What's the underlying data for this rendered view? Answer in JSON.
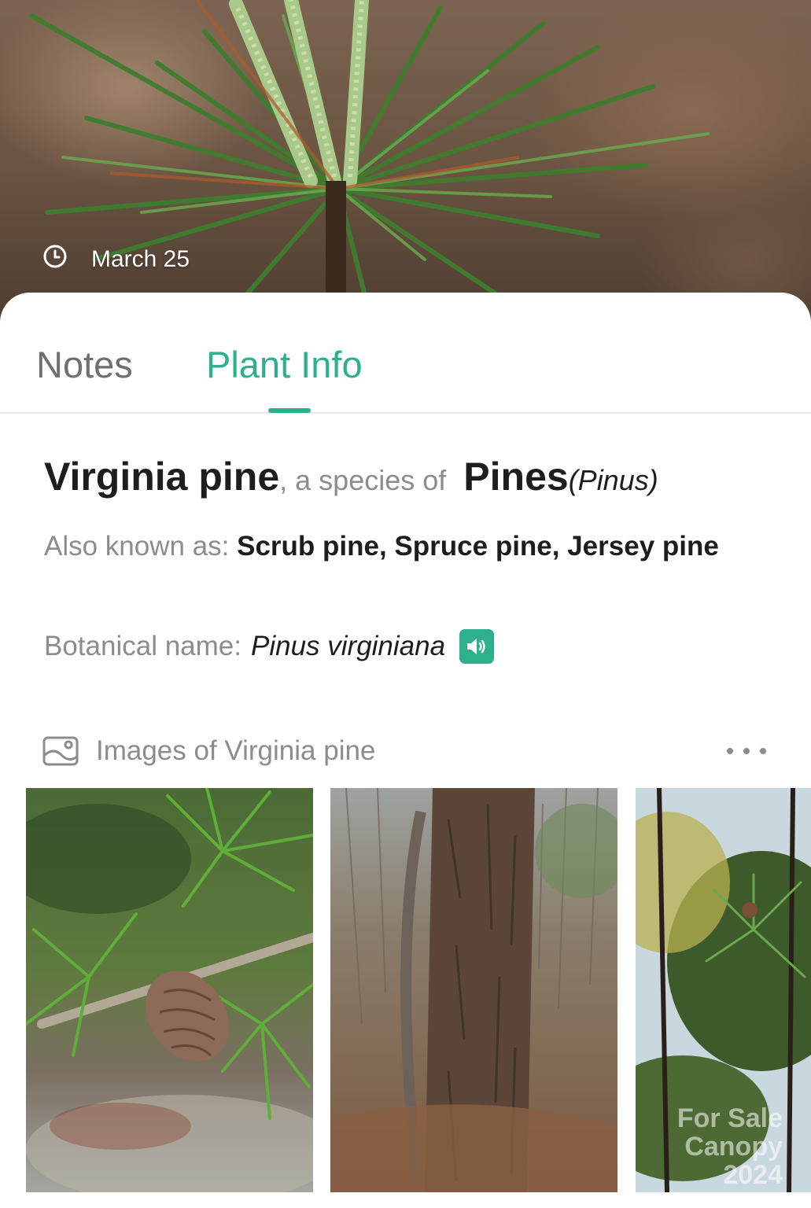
{
  "hero": {
    "date": "March 25",
    "clock_icon": "clock-icon"
  },
  "tabs": [
    {
      "label": "Notes",
      "active": false
    },
    {
      "label": "Plant Info",
      "active": true
    }
  ],
  "plant": {
    "common_name": "Virginia pine",
    "species_connector": ", a species of ",
    "genus_common": "Pines",
    "genus_latin": "(Pinus)",
    "aka_label": "Also known as: ",
    "aka_values": "Scrub pine, Spruce pine, Jersey pine",
    "botanical_label": "Botanical name: ",
    "botanical_value": "Pinus virginiana",
    "speaker_icon": "speaker-icon"
  },
  "images": {
    "title": "Images of Virginia pine",
    "icon": "gallery-icon",
    "more_icon": "more-horizontal-icon",
    "watermark_line1": "For Sale",
    "watermark_line2": "Canopy 2024"
  },
  "colors": {
    "accent": "#2fb08c",
    "text_primary": "#1d1d1d",
    "text_secondary": "#8c8c8c",
    "tab_inactive": "#6f6f6f"
  }
}
